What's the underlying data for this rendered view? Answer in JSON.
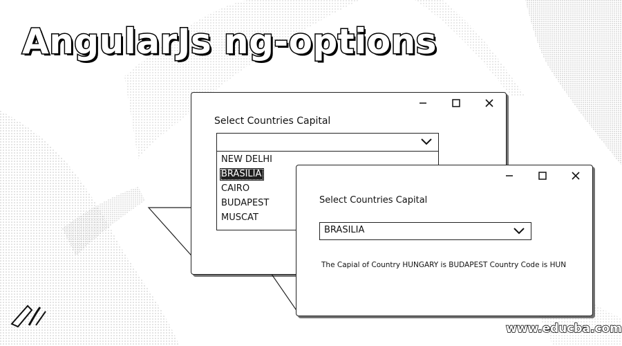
{
  "page_title": "AngularJs ng-options",
  "windows": {
    "back": {
      "label": "Select Countries Capital",
      "select_value": "",
      "options": [
        "NEW DELHI",
        "BRASILIA",
        "CAIRO",
        "BUDAPEST",
        "MUSCAT"
      ],
      "highlighted_option": "BRASILIA",
      "controls": {
        "minimize": "minimize-icon",
        "maximize": "maximize-icon",
        "close": "close-icon"
      }
    },
    "front": {
      "label": "Select Countries Capital",
      "select_value": "BRASILIA",
      "result": "The Capial of Country HUNGARY is BUDAPEST Country Code is HUN",
      "controls": {
        "minimize": "minimize-icon",
        "maximize": "maximize-icon",
        "close": "close-icon"
      }
    }
  },
  "watermark": "www.educba.com",
  "colors": {
    "ink": "#111111",
    "highlight": "#1f1f1f",
    "background": "#ffffff"
  }
}
